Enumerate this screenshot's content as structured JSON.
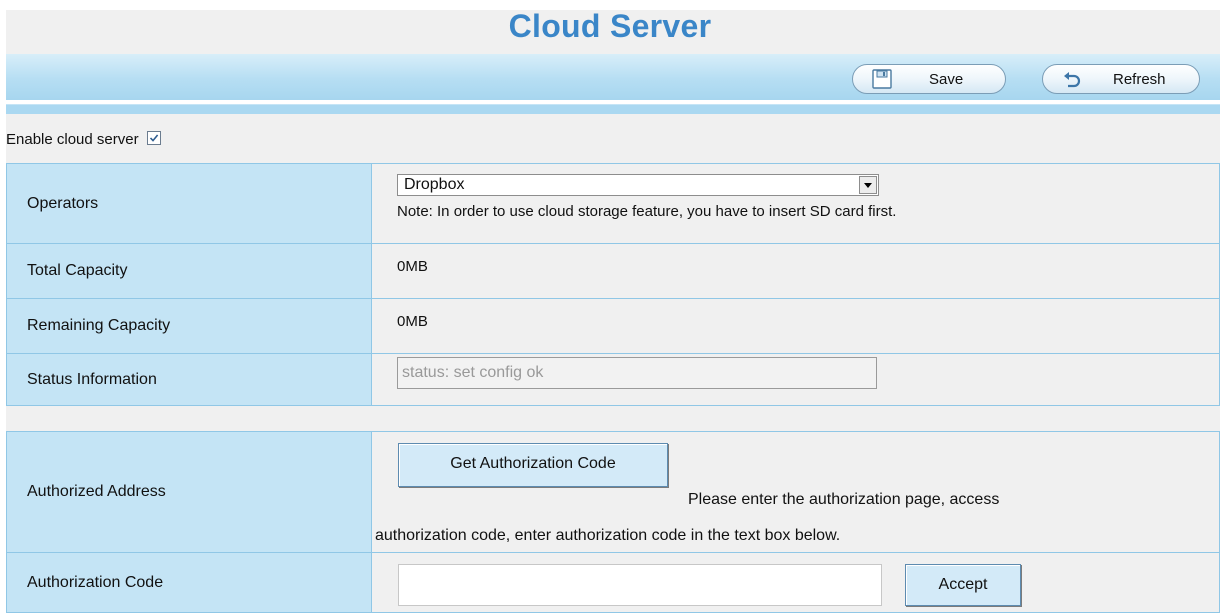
{
  "page": {
    "title": "Cloud Server"
  },
  "toolbar": {
    "save_label": "Save",
    "refresh_label": "Refresh",
    "save_icon": "save-icon",
    "refresh_icon": "refresh-icon"
  },
  "enable": {
    "label": "Enable cloud server",
    "checked": true
  },
  "settings": {
    "operators_label": "Operators",
    "operators_value": "Dropbox",
    "operators_note": "Note: In order to use cloud storage feature, you have to insert SD card first.",
    "total_label": "Total Capacity",
    "total_value": "0MB",
    "remaining_label": "Remaining Capacity",
    "remaining_value": "0MB",
    "status_label": "Status Information",
    "status_value": "status: set config ok"
  },
  "auth": {
    "address_label": "Authorized Address",
    "get_code_button": "Get Authorization Code",
    "hint_line1": "Please enter the authorization page, access",
    "hint_line2": "authorization code, enter authorization code in the text box below.",
    "code_label": "Authorization Code",
    "code_value": "",
    "accept_button": "Accept"
  },
  "colors": {
    "title": "#3a86c8",
    "label_cell": "#c4e4f5",
    "cell_border": "#90c7e6",
    "toolbar": "#b6def3"
  }
}
